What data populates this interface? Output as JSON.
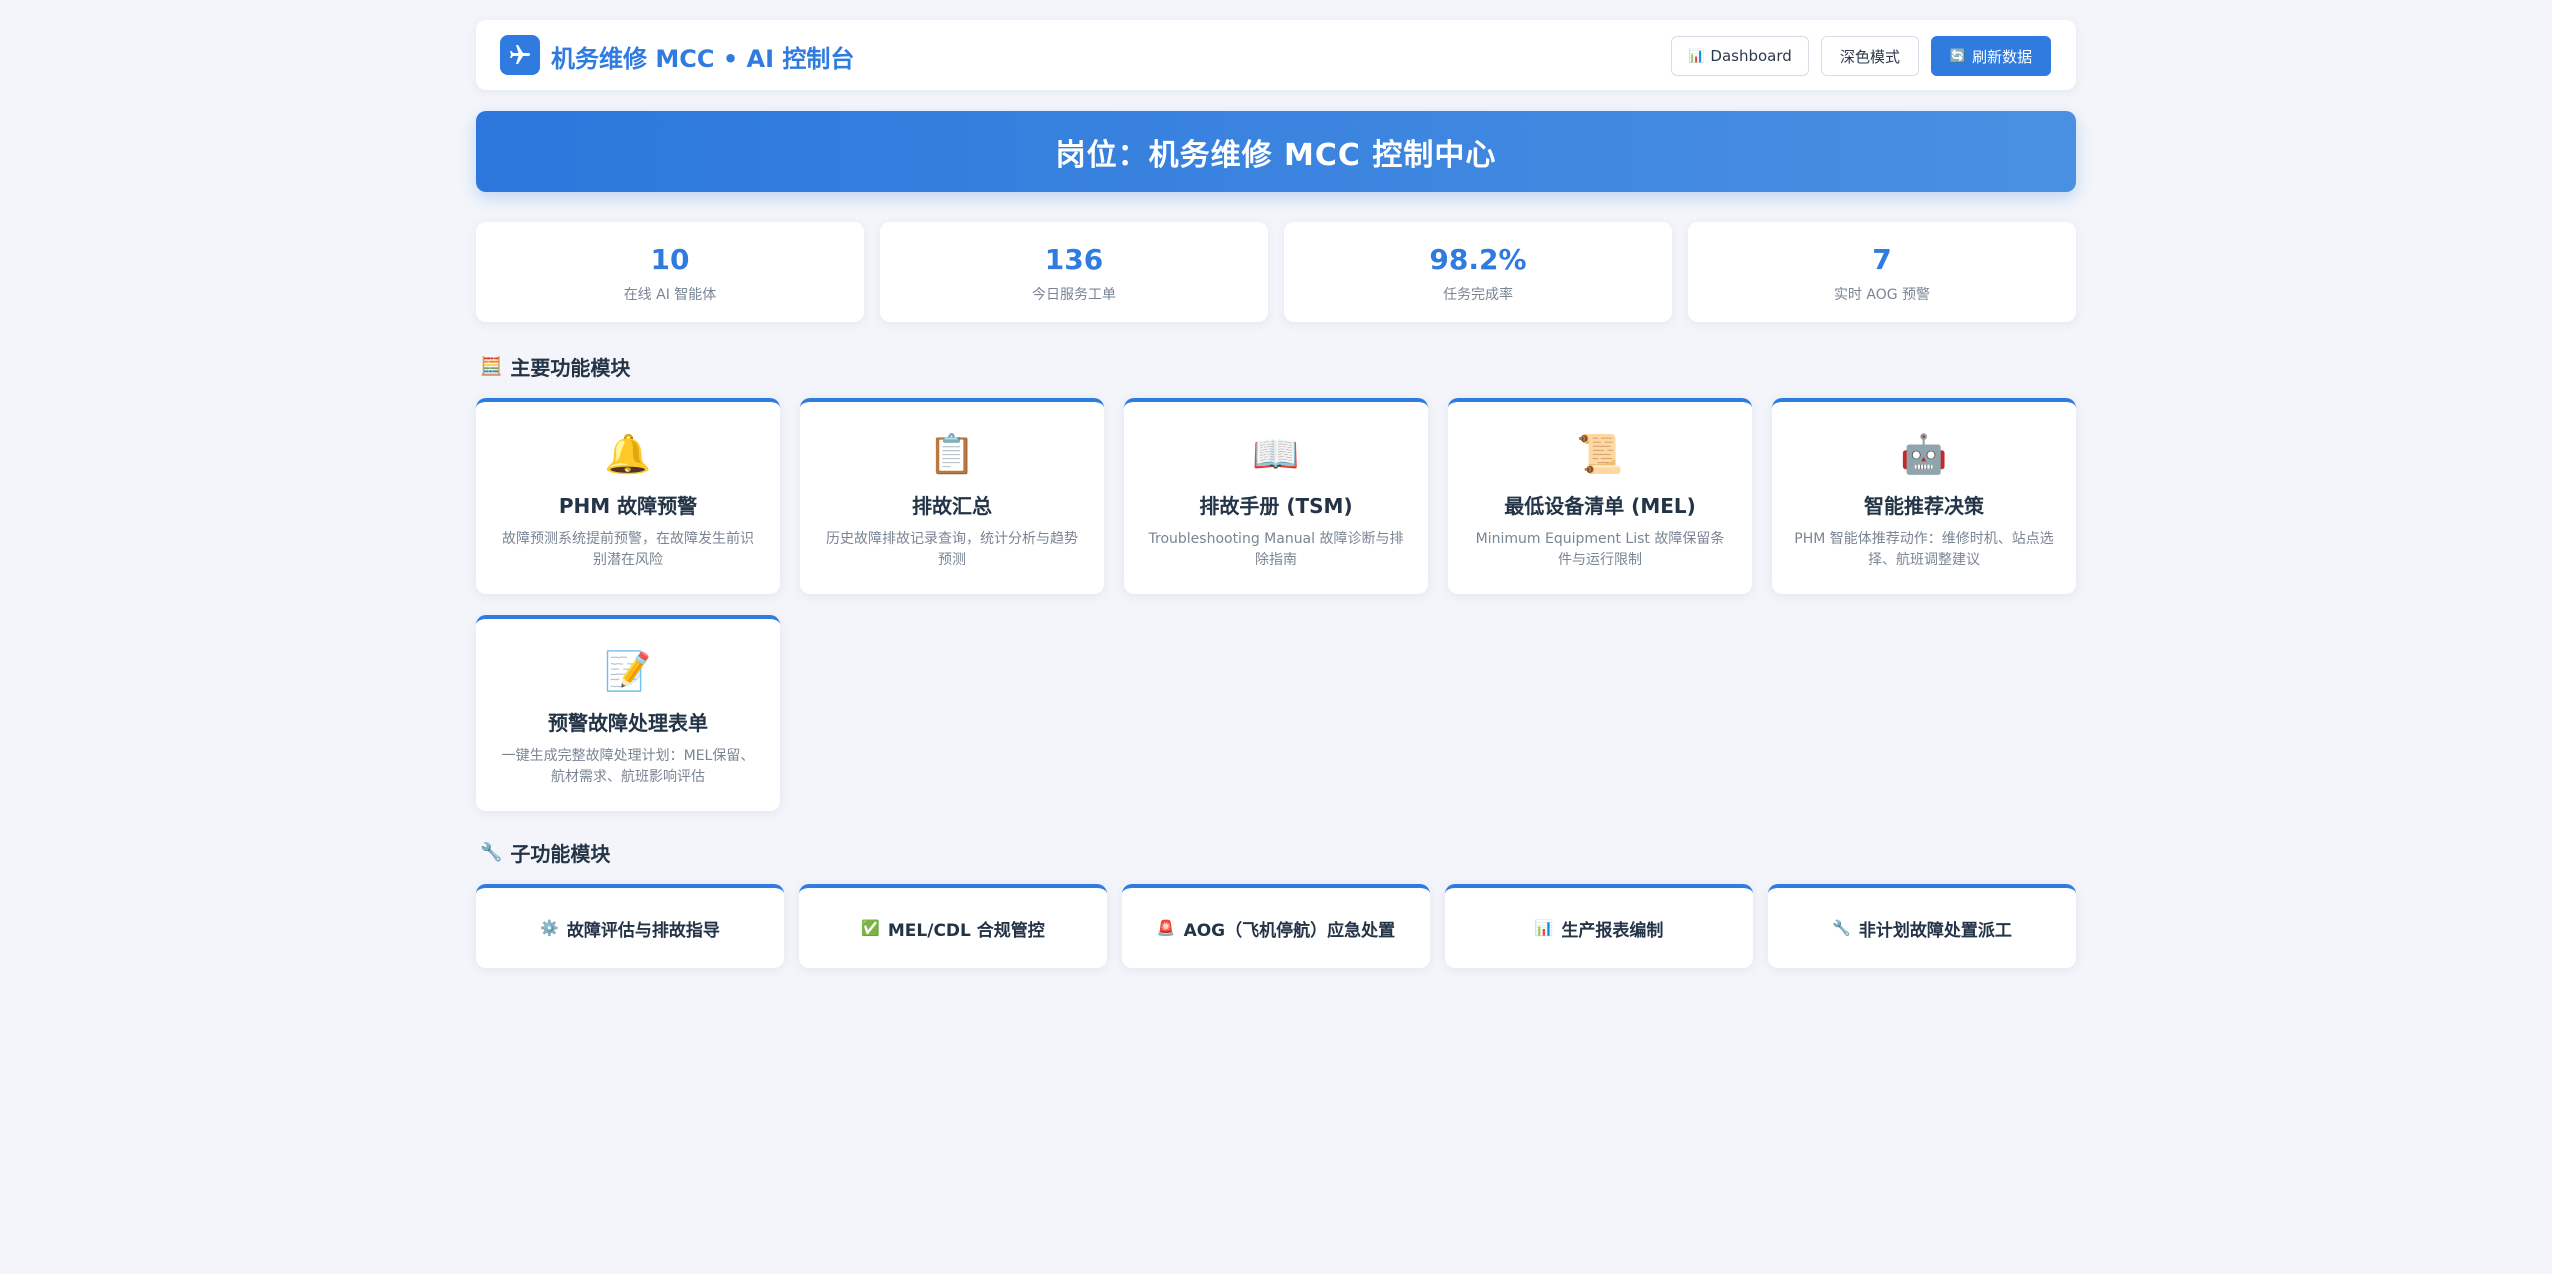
{
  "header": {
    "title": "机务维修 MCC • AI 控制台",
    "logo_icon": "airplane-icon",
    "buttons": {
      "dashboard": {
        "label": "Dashboard",
        "icon": "📊"
      },
      "dark_mode": {
        "label": "深色模式"
      },
      "refresh": {
        "label": "刷新数据",
        "icon": "🔄"
      }
    }
  },
  "banner": {
    "text": "岗位：机务维修 MCC 控制中心"
  },
  "stats": [
    {
      "value": "10",
      "label": "在线 AI 智能体"
    },
    {
      "value": "136",
      "label": "今日服务工单"
    },
    {
      "value": "98.2%",
      "label": "任务完成率"
    },
    {
      "value": "7",
      "label": "实时 AOG 预警"
    }
  ],
  "main_section": {
    "icon": "🧮",
    "title": "主要功能模块",
    "modules": [
      {
        "icon": "🔔",
        "title": "PHM 故障预警",
        "desc": "故障预测系统提前预警，在故障发生前识别潜在风险"
      },
      {
        "icon": "📋",
        "title": "排故汇总",
        "desc": "历史故障排故记录查询，统计分析与趋势预测"
      },
      {
        "icon": "📖",
        "title": "排故手册 (TSM)",
        "desc": "Troubleshooting Manual 故障诊断与排除指南"
      },
      {
        "icon": "📜",
        "title": "最低设备清单 (MEL)",
        "desc": "Minimum Equipment List 故障保留条件与运行限制"
      },
      {
        "icon": "🤖",
        "title": "智能推荐决策",
        "desc": "PHM 智能体推荐动作：维修时机、站点选择、航班调整建议"
      },
      {
        "icon": "📝",
        "title": "预警故障处理表单",
        "desc": "一键生成完整故障处理计划：MEL保留、航材需求、航班影响评估"
      }
    ]
  },
  "sub_section": {
    "icon": "🔧",
    "title": "子功能模块",
    "items": [
      {
        "icon": "⚙️",
        "label": "故障评估与排故指导"
      },
      {
        "icon": "✅",
        "label": "MEL/CDL 合规管控"
      },
      {
        "icon": "🚨",
        "label": "AOG（飞机停航）应急处置"
      },
      {
        "icon": "📊",
        "label": "生产报表编制"
      },
      {
        "icon": "🔧",
        "label": "非计划故障处置派工"
      }
    ]
  },
  "colors": {
    "accent": "#2f7be0",
    "background": "#f3f5fa"
  }
}
